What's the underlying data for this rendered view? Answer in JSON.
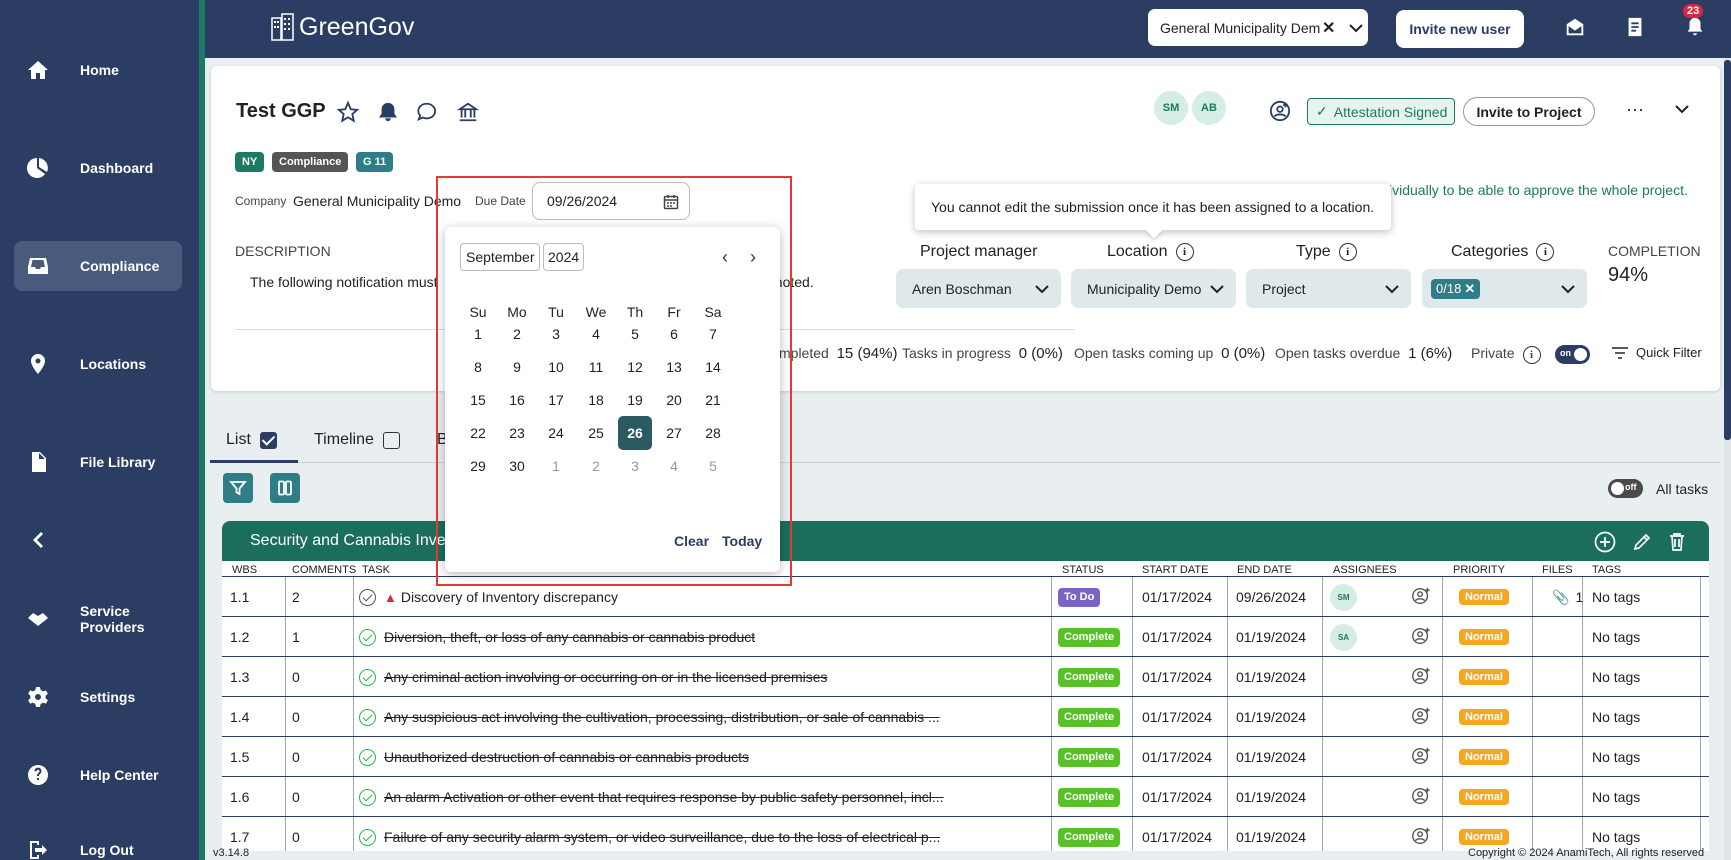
{
  "sidebar": {
    "items": [
      {
        "label": "Home",
        "icon": "home-icon"
      },
      {
        "label": "Dashboard",
        "icon": "pie-chart-icon"
      },
      {
        "label": "Compliance",
        "icon": "inbox-icon",
        "active": true
      },
      {
        "label": "Locations",
        "icon": "location-pin-icon"
      },
      {
        "label": "File Library",
        "icon": "file-icon"
      },
      {
        "label": "Service Providers",
        "icon": "handshake-icon"
      },
      {
        "label": "Settings",
        "icon": "gear-icon"
      },
      {
        "label": "Help Center",
        "icon": "help-icon"
      },
      {
        "label": "Log Out",
        "icon": "logout-icon"
      }
    ]
  },
  "header": {
    "brand": "GreenGov",
    "municipality_select": "General Municipality Demo",
    "invite_button": "Invite new user",
    "notification_count": "23"
  },
  "project": {
    "title": "Test GGP",
    "chips": [
      {
        "label": "NY",
        "color": "#1b7a64"
      },
      {
        "label": "Compliance",
        "color": "#555555"
      },
      {
        "label": "G 11",
        "color": "#2e7d87"
      }
    ],
    "company_label": "Company",
    "company_value": "General Municipality Demo",
    "due_date_label": "Due Date",
    "due_date_value": "09/26/2024",
    "description_label": "DESCRIPTION",
    "description_left": "The following notification must",
    "description_right": "t noted.",
    "avatars": [
      "SM",
      "AB"
    ],
    "attestation": "Attestation Signed",
    "invite_project": "Invite to Project",
    "approve_text": "ividually to be able to approve the whole project.",
    "tooltip": "You cannot edit the submission once it has been assigned to a location.",
    "fields": {
      "project_manager_label": "Project manager",
      "project_manager_value": "Aren Boschman",
      "location_label": "Location",
      "location_value": "Municipality Demo",
      "type_label": "Type",
      "type_value": "Project",
      "categories_label": "Categories",
      "categories_value": "0/18"
    },
    "completion_label": "COMPLETION",
    "completion_value": "94%",
    "stats": {
      "completed_label": "mpleted",
      "completed_value": "15 (94%)",
      "in_progress_label": "Tasks in progress",
      "in_progress_value": "0 (0%)",
      "coming_up_label": "Open tasks coming up",
      "coming_up_value": "0 (0%)",
      "overdue_label": "Open tasks overdue",
      "overdue_value": "1 (6%)",
      "private_label": "Private",
      "private_toggle": "on",
      "quick_filter": "Quick Filter"
    }
  },
  "views": {
    "list": "List",
    "timeline": "Timeline",
    "third_initial": "B",
    "all_tasks_toggle": "off",
    "all_tasks": "All tasks"
  },
  "table": {
    "group_title": "Security and Cannabis Inve",
    "headers": [
      "WBS",
      "COMMENTS",
      "TASK",
      "STATUS",
      "START DATE",
      "END DATE",
      "ASSIGNEES",
      "PRIORITY",
      "FILES",
      "TAGS"
    ],
    "rows": [
      {
        "wbs": "1.1",
        "comments": "2",
        "task": "Discovery of Inventory discrepancy",
        "done": false,
        "warning": true,
        "status": "To Do",
        "start": "01/17/2024",
        "end": "09/26/2024",
        "assignee": "SM",
        "priority": "Normal",
        "files": "1",
        "tags": "No tags"
      },
      {
        "wbs": "1.2",
        "comments": "1",
        "task": "Diversion, theft, or loss of any cannabis or cannabis product",
        "done": true,
        "status": "Complete",
        "start": "01/17/2024",
        "end": "01/19/2024",
        "assignee": "SA",
        "priority": "Normal",
        "files": "",
        "tags": "No tags"
      },
      {
        "wbs": "1.3",
        "comments": "0",
        "task": "Any criminal action involving or occurring on or in the licensed premises",
        "done": true,
        "status": "Complete",
        "start": "01/17/2024",
        "end": "01/19/2024",
        "assignee": "",
        "priority": "Normal",
        "files": "",
        "tags": "No tags"
      },
      {
        "wbs": "1.4",
        "comments": "0",
        "task": "Any suspicious act involving the cultivation, processing, distribution, or sale of cannabis ...",
        "done": true,
        "status": "Complete",
        "start": "01/17/2024",
        "end": "01/19/2024",
        "assignee": "",
        "priority": "Normal",
        "files": "",
        "tags": "No tags"
      },
      {
        "wbs": "1.5",
        "comments": "0",
        "task": "Unauthorized destruction of cannabis or cannabis products",
        "done": true,
        "status": "Complete",
        "start": "01/17/2024",
        "end": "01/19/2024",
        "assignee": "",
        "priority": "Normal",
        "files": "",
        "tags": "No tags"
      },
      {
        "wbs": "1.6",
        "comments": "0",
        "task": "An alarm Activation or other event that requires response by public safety personnel, incl...",
        "done": true,
        "status": "Complete",
        "start": "01/17/2024",
        "end": "01/19/2024",
        "assignee": "",
        "priority": "Normal",
        "files": "",
        "tags": "No tags"
      },
      {
        "wbs": "1.7",
        "comments": "0",
        "task": "Failure of any security alarm system, or video surveillance, due to the loss of electrical p...",
        "done": true,
        "status": "Complete",
        "start": "01/17/2024",
        "end": "01/19/2024",
        "assignee": "",
        "priority": "Normal",
        "files": "",
        "tags": "No tags"
      }
    ]
  },
  "datepicker": {
    "month": "September",
    "year": "2024",
    "weekdays": [
      "Su",
      "Mo",
      "Tu",
      "We",
      "Th",
      "Fr",
      "Sa"
    ],
    "weeks": [
      [
        "1",
        "2",
        "3",
        "4",
        "5",
        "6",
        "7"
      ],
      [
        "8",
        "9",
        "10",
        "11",
        "12",
        "13",
        "14"
      ],
      [
        "15",
        "16",
        "17",
        "18",
        "19",
        "20",
        "21"
      ],
      [
        "22",
        "23",
        "24",
        "25",
        "26",
        "27",
        "28"
      ],
      [
        "29",
        "30",
        "1",
        "2",
        "3",
        "4",
        "5"
      ]
    ],
    "selected": "26",
    "clear": "Clear",
    "today": "Today"
  },
  "footer": {
    "version": "v3.14.8",
    "copyright": "Copyright © 2024 AnamiTech, All rights reserved"
  }
}
